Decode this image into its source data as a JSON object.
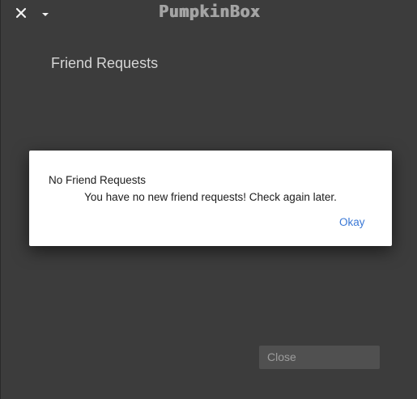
{
  "app": {
    "title": "PumpkinBox",
    "close_icon": "close-icon",
    "menu_icon": "chevron-down-icon"
  },
  "page": {
    "heading": "Friend Requests"
  },
  "dialog": {
    "title": "No Friend Requests",
    "message": "You have no new friend requests! Check again later.",
    "ok_label": "Okay"
  },
  "footer": {
    "close_label": "Close"
  },
  "colors": {
    "background": "#3c3c3c",
    "dialog_background": "#ffffff",
    "accent": "#3a78d6",
    "button_background": "#505050"
  }
}
